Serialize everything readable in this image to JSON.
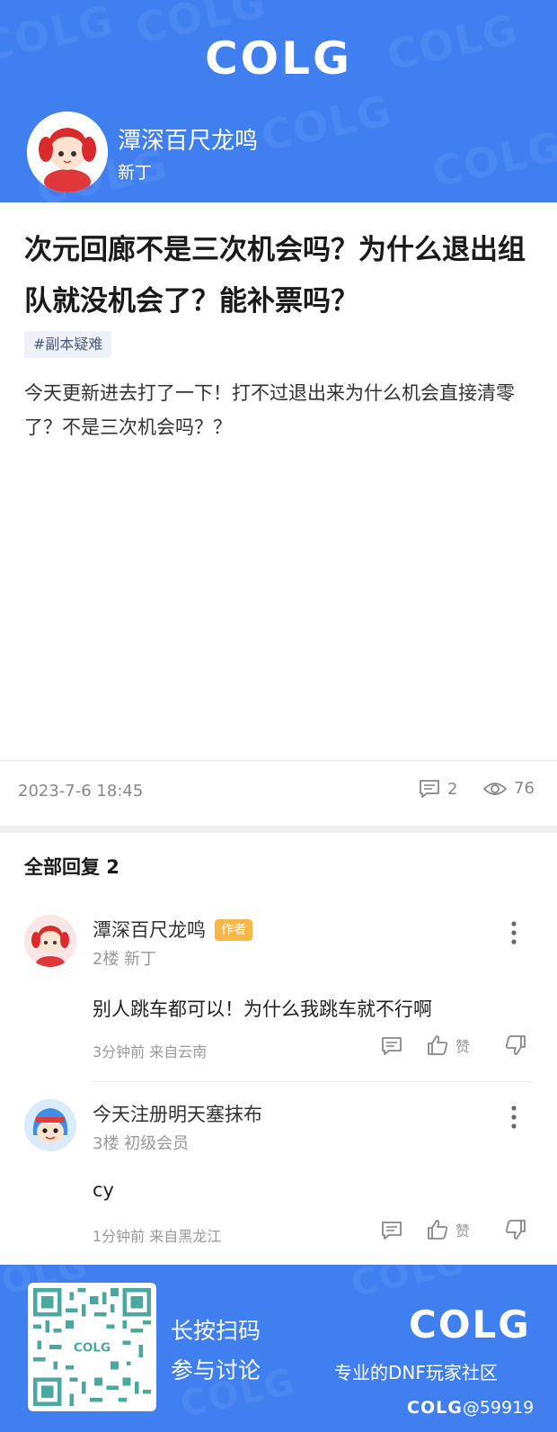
{
  "header": {
    "logo": "COLG",
    "author_name": "潭深百尺龙鸣",
    "author_rank": "新丁"
  },
  "post": {
    "title": "次元回廊不是三次机会吗？为什么退出组队就没机会了？能补票吗？",
    "tag": "#副本疑难",
    "body": "今天更新进去打了一下！打不过退出来为什么机会直接清零了？不是三次机会吗？？",
    "date": "2023-7-6 18:45",
    "comment_count": "2",
    "view_count": "76"
  },
  "replies": {
    "heading": "全部回复  2",
    "items": [
      {
        "name": "潭深百尺龙鸣",
        "badge": "作者",
        "sub": "2楼  新丁",
        "text": "别人跳车都可以！为什么我跳车就不行啊",
        "time": "3分钟前  来自云南",
        "like_label": "赞"
      },
      {
        "name": "今天注册明天塞抹布",
        "sub": "3楼  初级会员",
        "text": "cy",
        "time": "1分钟前  来自黑龙江",
        "like_label": "赞"
      }
    ]
  },
  "footer": {
    "scan_line1": "长按扫码",
    "scan_line2": "参与讨论",
    "logo": "COLG",
    "slogan": "专业的DNF玩家社区",
    "handle_logo": "COLG",
    "handle": "@59919"
  },
  "colors": {
    "brand_blue": "#3f7ff0",
    "author_badge": "#f6b744"
  }
}
